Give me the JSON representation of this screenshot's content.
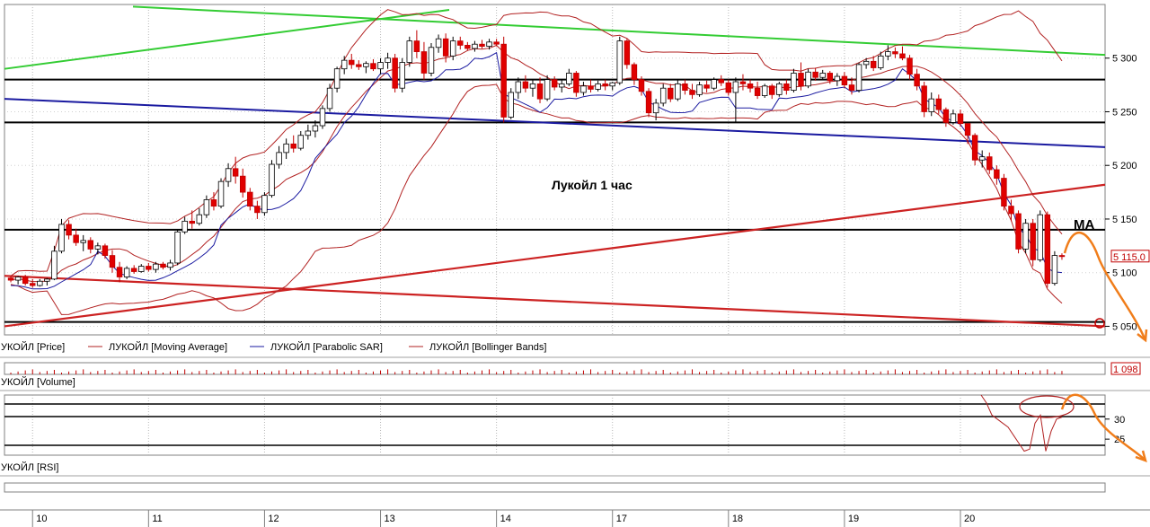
{
  "chart_data": {
    "type": "candlestick",
    "annotation": "Лукойл   1 час",
    "ma_label": "MA",
    "price_axis": {
      "ylim": [
        5042,
        5350
      ],
      "ticks": [
        5050,
        5100,
        5150,
        5200,
        5250,
        5300
      ],
      "tick_labels": [
        "5 050",
        "5 100",
        "5 150",
        "5 200",
        "5 250",
        "5 300"
      ],
      "last_price": 5115,
      "last_price_label": "5 115,0"
    },
    "legend": [
      {
        "label": "УКОЙЛ [Price]",
        "color": ""
      },
      {
        "label": "ЛУКОЙЛ [Moving Average]",
        "color": "#b22222"
      },
      {
        "label": "ЛУКОЙЛ [Parabolic SAR]",
        "color": "#1a1aa0"
      },
      {
        "label": "ЛУКОЙЛ [Bollinger Bands]",
        "color": "#b22222"
      }
    ],
    "volume_panel": {
      "label": "УКОЙЛ [Volume]",
      "last_value_label": "1 098"
    },
    "rsi_panel": {
      "label": "УКОЙЛ [RSI]",
      "ylim": [
        21,
        36
      ],
      "ticks": [
        25,
        30
      ],
      "tick_labels": [
        "25",
        "30"
      ]
    },
    "x_axis": {
      "dates": [
        "10",
        "11",
        "12",
        "13",
        "14",
        "17",
        "18",
        "19",
        "20"
      ],
      "count": 150,
      "date_start_index": [
        4,
        20,
        36,
        52,
        68,
        84,
        100,
        116,
        132
      ]
    },
    "candles": [
      [
        5095,
        5097,
        5091,
        5093
      ],
      [
        5093,
        5097,
        5089,
        5096
      ],
      [
        5096,
        5098,
        5088,
        5090
      ],
      [
        5090,
        5094,
        5086,
        5088
      ],
      [
        5088,
        5094,
        5087,
        5092
      ],
      [
        5092,
        5095,
        5088,
        5094
      ],
      [
        5094,
        5125,
        5093,
        5120
      ],
      [
        5120,
        5150,
        5118,
        5145
      ],
      [
        5145,
        5149,
        5131,
        5135
      ],
      [
        5135,
        5141,
        5125,
        5128
      ],
      [
        5128,
        5135,
        5120,
        5130
      ],
      [
        5130,
        5133,
        5118,
        5122
      ],
      [
        5122,
        5128,
        5117,
        5125
      ],
      [
        5125,
        5127,
        5113,
        5116
      ],
      [
        5116,
        5121,
        5100,
        5105
      ],
      [
        5105,
        5110,
        5091,
        5096
      ],
      [
        5096,
        5106,
        5094,
        5104
      ],
      [
        5104,
        5107,
        5099,
        5101
      ],
      [
        5101,
        5108,
        5100,
        5106
      ],
      [
        5106,
        5109,
        5101,
        5103
      ],
      [
        5103,
        5110,
        5100,
        5108
      ],
      [
        5108,
        5110,
        5103,
        5105
      ],
      [
        5105,
        5112,
        5102,
        5109
      ],
      [
        5109,
        5140,
        5107,
        5138
      ],
      [
        5138,
        5152,
        5136,
        5148
      ],
      [
        5148,
        5158,
        5141,
        5146
      ],
      [
        5146,
        5160,
        5144,
        5154
      ],
      [
        5154,
        5172,
        5151,
        5168
      ],
      [
        5168,
        5175,
        5158,
        5162
      ],
      [
        5162,
        5188,
        5160,
        5185
      ],
      [
        5185,
        5202,
        5180,
        5197
      ],
      [
        5197,
        5208,
        5183,
        5190
      ],
      [
        5190,
        5197,
        5170,
        5175
      ],
      [
        5175,
        5179,
        5158,
        5162
      ],
      [
        5162,
        5167,
        5150,
        5156
      ],
      [
        5156,
        5175,
        5153,
        5172
      ],
      [
        5172,
        5205,
        5170,
        5201
      ],
      [
        5201,
        5218,
        5197,
        5212
      ],
      [
        5212,
        5225,
        5206,
        5220
      ],
      [
        5220,
        5228,
        5212,
        5216
      ],
      [
        5216,
        5232,
        5214,
        5228
      ],
      [
        5228,
        5238,
        5224,
        5232
      ],
      [
        5232,
        5242,
        5226,
        5237
      ],
      [
        5237,
        5256,
        5234,
        5253
      ],
      [
        5253,
        5276,
        5250,
        5272
      ],
      [
        5272,
        5292,
        5268,
        5290
      ],
      [
        5290,
        5302,
        5285,
        5298
      ],
      [
        5298,
        5304,
        5290,
        5294
      ],
      [
        5294,
        5298,
        5289,
        5292
      ],
      [
        5292,
        5297,
        5286,
        5295
      ],
      [
        5295,
        5299,
        5288,
        5290
      ],
      [
        5290,
        5300,
        5285,
        5296
      ],
      [
        5296,
        5305,
        5290,
        5300
      ],
      [
        5300,
        5304,
        5268,
        5272
      ],
      [
        5272,
        5300,
        5268,
        5296
      ],
      [
        5296,
        5320,
        5292,
        5316
      ],
      [
        5316,
        5326,
        5300,
        5306
      ],
      [
        5306,
        5315,
        5280,
        5286
      ],
      [
        5286,
        5314,
        5283,
        5310
      ],
      [
        5310,
        5322,
        5305,
        5318
      ],
      [
        5318,
        5323,
        5296,
        5302
      ],
      [
        5302,
        5320,
        5298,
        5316
      ],
      [
        5316,
        5320,
        5308,
        5312
      ],
      [
        5312,
        5315,
        5307,
        5309
      ],
      [
        5309,
        5316,
        5306,
        5313
      ],
      [
        5313,
        5317,
        5309,
        5311
      ],
      [
        5311,
        5318,
        5308,
        5315
      ],
      [
        5315,
        5318,
        5311,
        5313
      ],
      [
        5313,
        5320,
        5240,
        5245
      ],
      [
        5245,
        5272,
        5243,
        5268
      ],
      [
        5268,
        5282,
        5262,
        5278
      ],
      [
        5278,
        5284,
        5268,
        5272
      ],
      [
        5272,
        5280,
        5264,
        5276
      ],
      [
        5276,
        5282,
        5258,
        5262
      ],
      [
        5262,
        5284,
        5260,
        5280
      ],
      [
        5280,
        5283,
        5270,
        5273
      ],
      [
        5273,
        5280,
        5268,
        5276
      ],
      [
        5276,
        5290,
        5274,
        5286
      ],
      [
        5286,
        5288,
        5264,
        5268
      ],
      [
        5268,
        5278,
        5265,
        5274
      ],
      [
        5274,
        5280,
        5268,
        5271
      ],
      [
        5271,
        5279,
        5269,
        5276
      ],
      [
        5276,
        5280,
        5270,
        5274
      ],
      [
        5274,
        5278,
        5270,
        5277
      ],
      [
        5277,
        5320,
        5275,
        5316
      ],
      [
        5316,
        5318,
        5290,
        5294
      ],
      [
        5294,
        5296,
        5275,
        5280
      ],
      [
        5280,
        5283,
        5265,
        5269
      ],
      [
        5269,
        5272,
        5245,
        5249
      ],
      [
        5249,
        5262,
        5242,
        5258
      ],
      [
        5258,
        5276,
        5255,
        5272
      ],
      [
        5272,
        5276,
        5259,
        5262
      ],
      [
        5262,
        5280,
        5260,
        5276
      ],
      [
        5276,
        5280,
        5266,
        5270
      ],
      [
        5270,
        5276,
        5262,
        5266
      ],
      [
        5266,
        5278,
        5264,
        5275
      ],
      [
        5275,
        5279,
        5268,
        5272
      ],
      [
        5272,
        5282,
        5270,
        5280
      ],
      [
        5280,
        5284,
        5274,
        5277
      ],
      [
        5277,
        5280,
        5265,
        5268
      ],
      [
        5268,
        5282,
        5240,
        5278
      ],
      [
        5278,
        5285,
        5270,
        5276
      ],
      [
        5276,
        5280,
        5268,
        5272
      ],
      [
        5272,
        5278,
        5262,
        5265
      ],
      [
        5265,
        5276,
        5263,
        5274
      ],
      [
        5274,
        5276,
        5262,
        5266
      ],
      [
        5266,
        5278,
        5264,
        5276
      ],
      [
        5276,
        5280,
        5266,
        5270
      ],
      [
        5270,
        5290,
        5268,
        5286
      ],
      [
        5286,
        5296,
        5270,
        5274
      ],
      [
        5274,
        5290,
        5272,
        5287
      ],
      [
        5287,
        5291,
        5279,
        5282
      ],
      [
        5282,
        5289,
        5280,
        5286
      ],
      [
        5286,
        5288,
        5276,
        5279
      ],
      [
        5279,
        5286,
        5274,
        5283
      ],
      [
        5283,
        5287,
        5272,
        5275
      ],
      [
        5275,
        5282,
        5266,
        5270
      ],
      [
        5270,
        5296,
        5268,
        5294
      ],
      [
        5294,
        5300,
        5290,
        5297
      ],
      [
        5297,
        5302,
        5288,
        5291
      ],
      [
        5291,
        5306,
        5289,
        5302
      ],
      [
        5302,
        5312,
        5298,
        5306
      ],
      [
        5306,
        5310,
        5300,
        5304
      ],
      [
        5304,
        5311,
        5298,
        5300
      ],
      [
        5300,
        5303,
        5280,
        5285
      ],
      [
        5285,
        5290,
        5270,
        5274
      ],
      [
        5274,
        5278,
        5245,
        5250
      ],
      [
        5250,
        5268,
        5246,
        5262
      ],
      [
        5262,
        5266,
        5248,
        5252
      ],
      [
        5252,
        5254,
        5236,
        5240
      ],
      [
        5240,
        5252,
        5238,
        5248
      ],
      [
        5248,
        5252,
        5236,
        5239
      ],
      [
        5239,
        5236,
        5220,
        5228
      ],
      [
        5228,
        5230,
        5200,
        5205
      ],
      [
        5205,
        5214,
        5198,
        5208
      ],
      [
        5208,
        5212,
        5192,
        5196
      ],
      [
        5196,
        5200,
        5182,
        5188
      ],
      [
        5188,
        5192,
        5158,
        5162
      ],
      [
        5162,
        5168,
        5148,
        5155
      ],
      [
        5155,
        5158,
        5118,
        5122
      ],
      [
        5122,
        5150,
        5118,
        5146
      ],
      [
        5146,
        5150,
        5106,
        5112
      ],
      [
        5112,
        5158,
        5110,
        5154
      ],
      [
        5154,
        5157,
        5086,
        5090
      ],
      [
        5090,
        5120,
        5088,
        5116
      ],
      [
        5116,
        5118,
        5112,
        5115
      ]
    ]
  }
}
